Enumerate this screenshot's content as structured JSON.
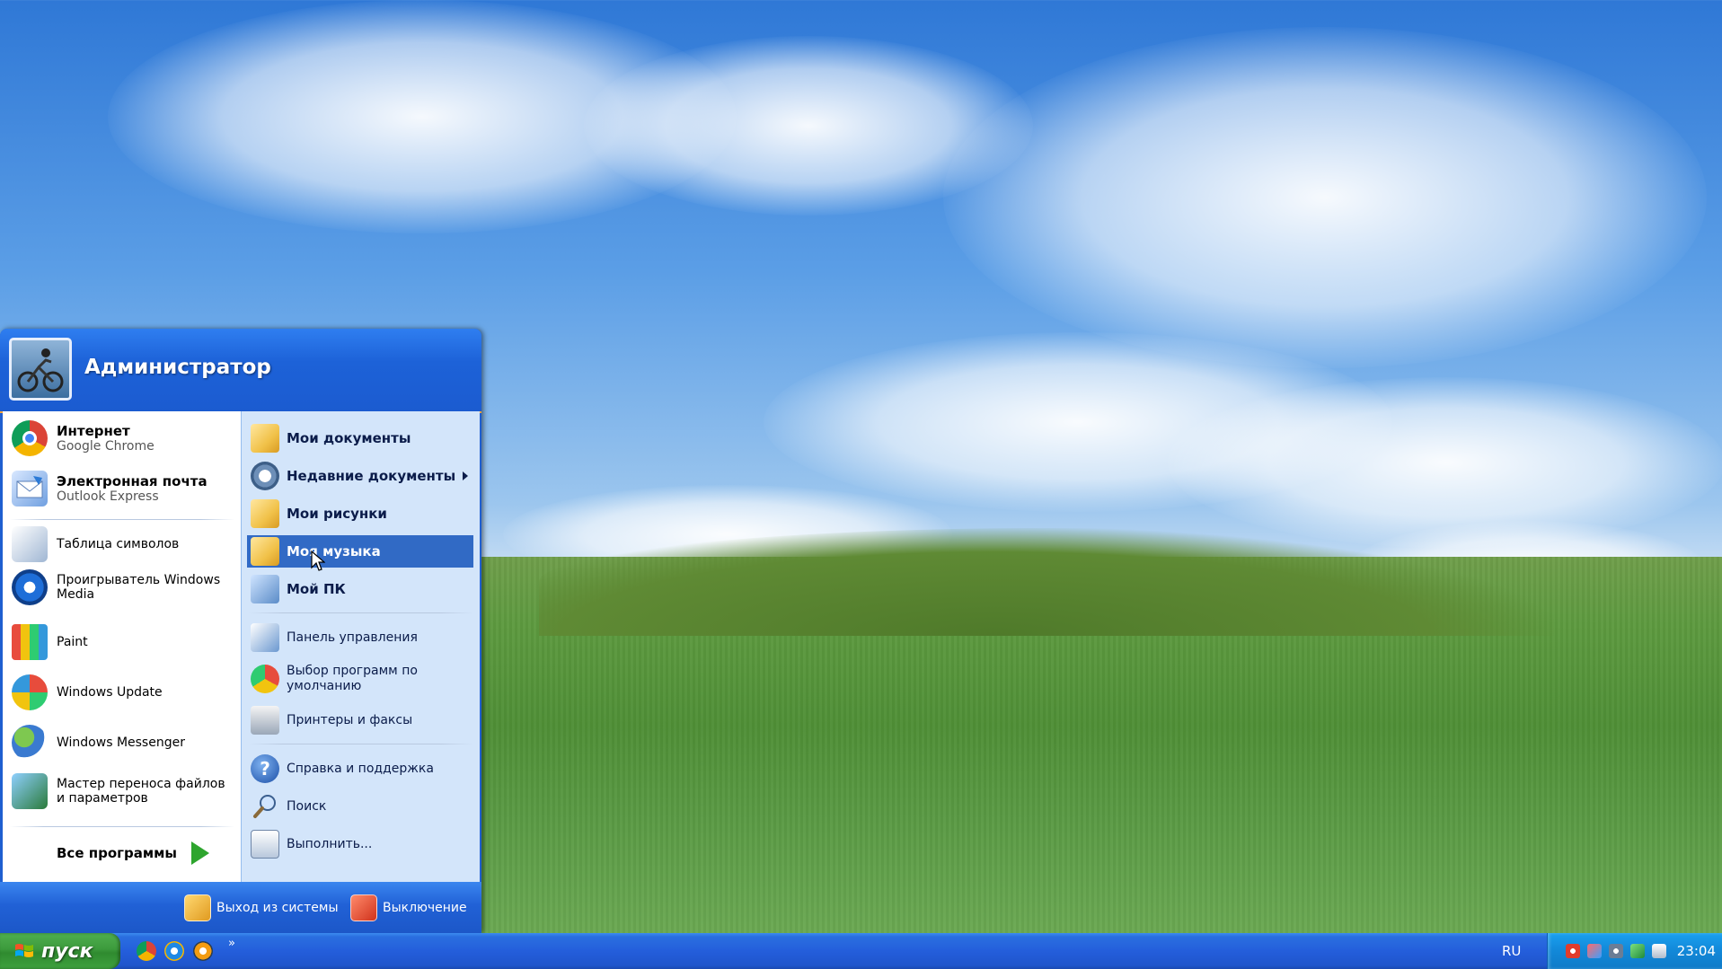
{
  "start_menu": {
    "user_name": "Администратор",
    "pinned": [
      {
        "title": "Интернет",
        "subtitle": "Google Chrome",
        "icon": "chrome-icon"
      },
      {
        "title": "Электронная почта",
        "subtitle": "Outlook Express",
        "icon": "outlook-express-icon"
      }
    ],
    "recent": [
      {
        "label": "Таблица символов",
        "icon": "character-map-icon"
      },
      {
        "label": "Проигрыватель Windows Media",
        "icon": "windows-media-player-icon"
      },
      {
        "label": "Paint",
        "icon": "paint-icon"
      },
      {
        "label": "Windows Update",
        "icon": "windows-update-icon"
      },
      {
        "label": "Windows Messenger",
        "icon": "windows-messenger-icon"
      },
      {
        "label": "Мастер переноса файлов и параметров",
        "icon": "transfer-wizard-icon"
      }
    ],
    "all_programs": "Все программы",
    "places": [
      {
        "label": "Мои документы",
        "icon": "my-documents-icon"
      },
      {
        "label": "Недавние документы",
        "icon": "recent-documents-icon"
      },
      {
        "label": "Мои рисунки",
        "icon": "my-pictures-icon"
      },
      {
        "label": "Моя музыка",
        "icon": "my-music-icon"
      },
      {
        "label": "Мой ПК",
        "icon": "my-computer-icon"
      }
    ],
    "system": [
      {
        "label": "Панель управления",
        "icon": "control-panel-icon"
      },
      {
        "label": "Выбор программ по умолчанию",
        "icon": "default-programs-icon"
      },
      {
        "label": "Принтеры и факсы",
        "icon": "printers-icon"
      }
    ],
    "tools": [
      {
        "label": "Справка и поддержка",
        "icon": "help-icon"
      },
      {
        "label": "Поиск",
        "icon": "search-icon"
      },
      {
        "label": "Выполнить...",
        "icon": "run-icon"
      }
    ],
    "logoff": "Выход из системы",
    "shutdown": "Выключение",
    "highlighted": "Моя музыка"
  },
  "taskbar": {
    "start_label": "пуск",
    "quick_launch": [
      "chrome-icon",
      "internet-explorer-icon",
      "media-player-icon"
    ],
    "quick_launch_more": "»",
    "language": "RU",
    "clock": "23:04"
  },
  "colors": {
    "taskbar_blue": "#245edb",
    "start_green": "#3c9a3c",
    "highlight": "#316ac5",
    "menu_right_bg": "#d3e5fa"
  }
}
